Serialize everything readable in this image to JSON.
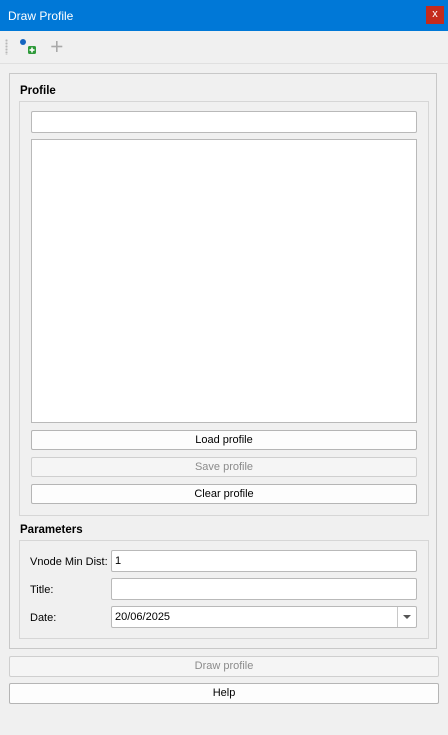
{
  "window": {
    "title": "Draw Profile",
    "close_label": "x"
  },
  "toolbar": {
    "add_point_icon": "add-point-icon",
    "add_icon": "plus-icon"
  },
  "profile": {
    "section_title": "Profile",
    "name_value": "",
    "load_label": "Load profile",
    "save_label": "Save profile",
    "clear_label": "Clear profile"
  },
  "parameters": {
    "section_title": "Parameters",
    "vnode_label": "Vnode Min Dist:",
    "vnode_value": "1",
    "title_label": "Title:",
    "title_value": "",
    "date_label": "Date:",
    "date_value": "20/06/2025"
  },
  "footer": {
    "draw_label": "Draw profile",
    "help_label": "Help"
  },
  "colors": {
    "titlebar": "#0078d7",
    "close": "#c42b1c",
    "add_point_dot": "#1565c0",
    "add_point_plus": "#2e9a3a"
  }
}
